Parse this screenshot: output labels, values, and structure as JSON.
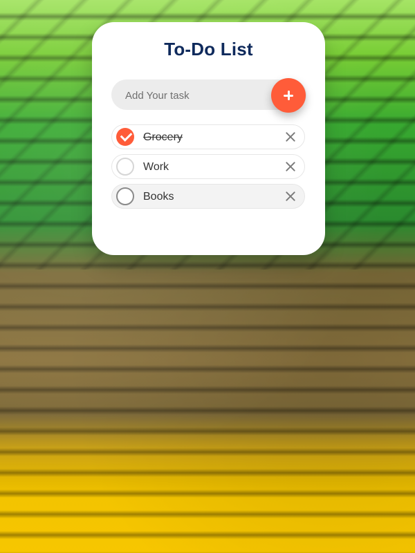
{
  "app": {
    "title": "To-Do List"
  },
  "input": {
    "placeholder": "Add Your task"
  },
  "tasks": [
    {
      "label": "Grocery",
      "completed": true
    },
    {
      "label": "Work",
      "completed": false
    },
    {
      "label": "Books",
      "completed": false
    }
  ],
  "icons": {
    "add": "plus-icon",
    "check": "checkmark-icon",
    "remove": "close-icon"
  },
  "colors": {
    "accent": "#ff5c39",
    "title": "#0f2a5c",
    "input_bg": "#ececec",
    "icon_gray": "#7b7b7b"
  }
}
